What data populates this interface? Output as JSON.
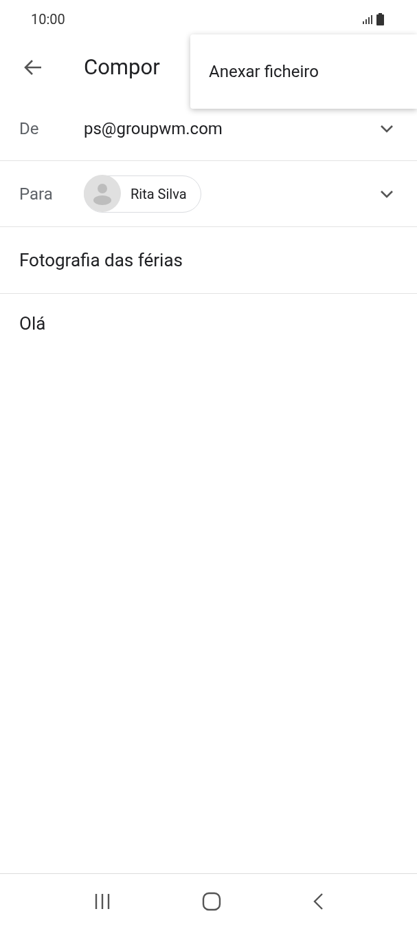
{
  "status_bar": {
    "time": "10:00"
  },
  "app_bar": {
    "title": "Compor"
  },
  "menu": {
    "items": [
      {
        "label": "Anexar ficheiro"
      }
    ]
  },
  "from": {
    "label": "De",
    "value": "ps@groupwm.com"
  },
  "to": {
    "label": "Para",
    "recipients": [
      {
        "name": "Rita Silva"
      }
    ]
  },
  "subject": {
    "value": "Fotografia das férias"
  },
  "body": {
    "value": "Olá"
  }
}
